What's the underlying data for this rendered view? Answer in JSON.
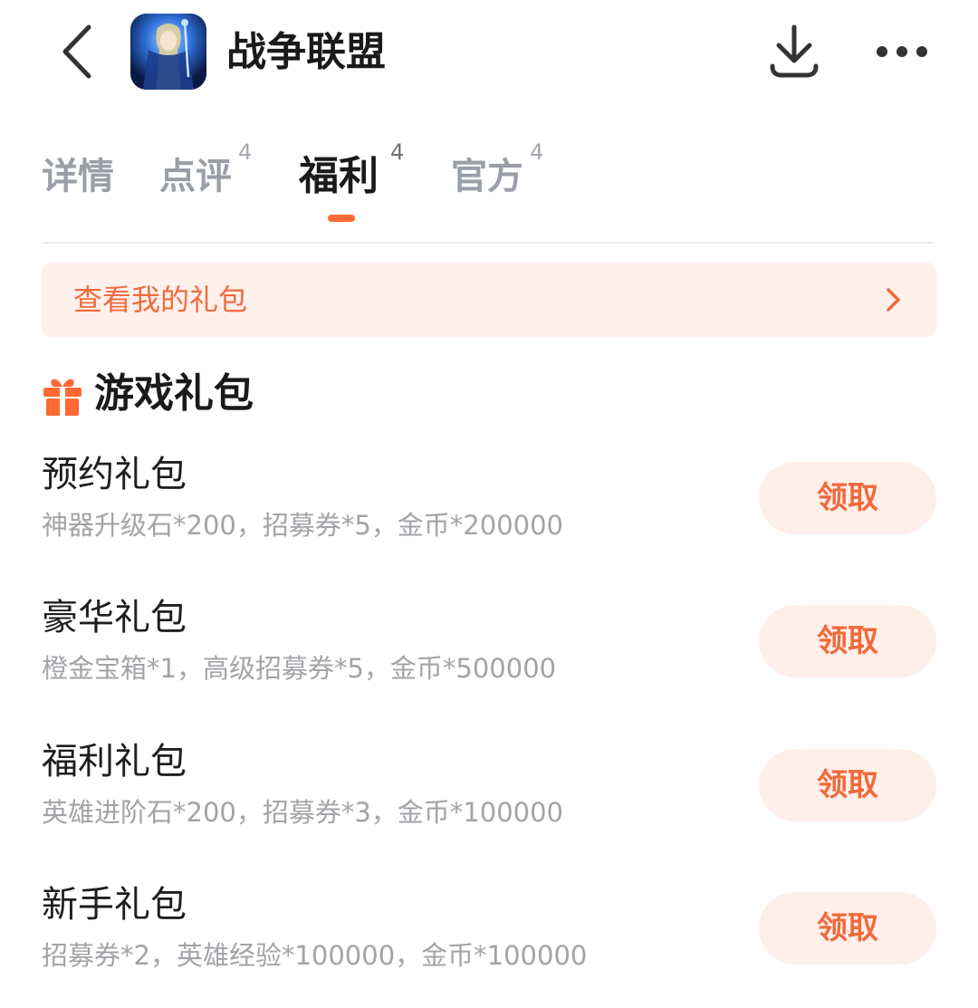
{
  "header": {
    "back_icon": "chevron-left-icon",
    "title": "战争联盟",
    "download_icon": "download-icon",
    "more_icon": "more-horizontal-icon"
  },
  "tabs": [
    {
      "label": "详情",
      "count": ""
    },
    {
      "label": "点评",
      "count": "4"
    },
    {
      "label": "福利",
      "count": "4",
      "active": true
    },
    {
      "label": "官方",
      "count": "4"
    }
  ],
  "my_gifts": {
    "label": "查看我的礼包",
    "arrow_icon": "chevron-right-icon"
  },
  "section": {
    "icon": "gift-icon",
    "title": "游戏礼包"
  },
  "gifts": [
    {
      "name": "预约礼包",
      "desc": "神器升级石*200，招募券*5，金币*200000",
      "button": "领取"
    },
    {
      "name": "豪华礼包",
      "desc": "橙金宝箱*1，高级招募券*5，金币*500000",
      "button": "领取"
    },
    {
      "name": "福利礼包",
      "desc": "英雄进阶石*200，招募券*3，金币*100000",
      "button": "领取"
    },
    {
      "name": "新手礼包",
      "desc": "招募券*2，英雄经验*100000，金币*100000",
      "button": "领取"
    }
  ],
  "colors": {
    "accent": "#ff6a34",
    "accent_text": "#f06a3c",
    "banner_bg": "#fff0eb",
    "button_bg": "#ffefe9",
    "muted_text": "#a3a3a8",
    "inactive_tab": "#9a9ea6"
  }
}
